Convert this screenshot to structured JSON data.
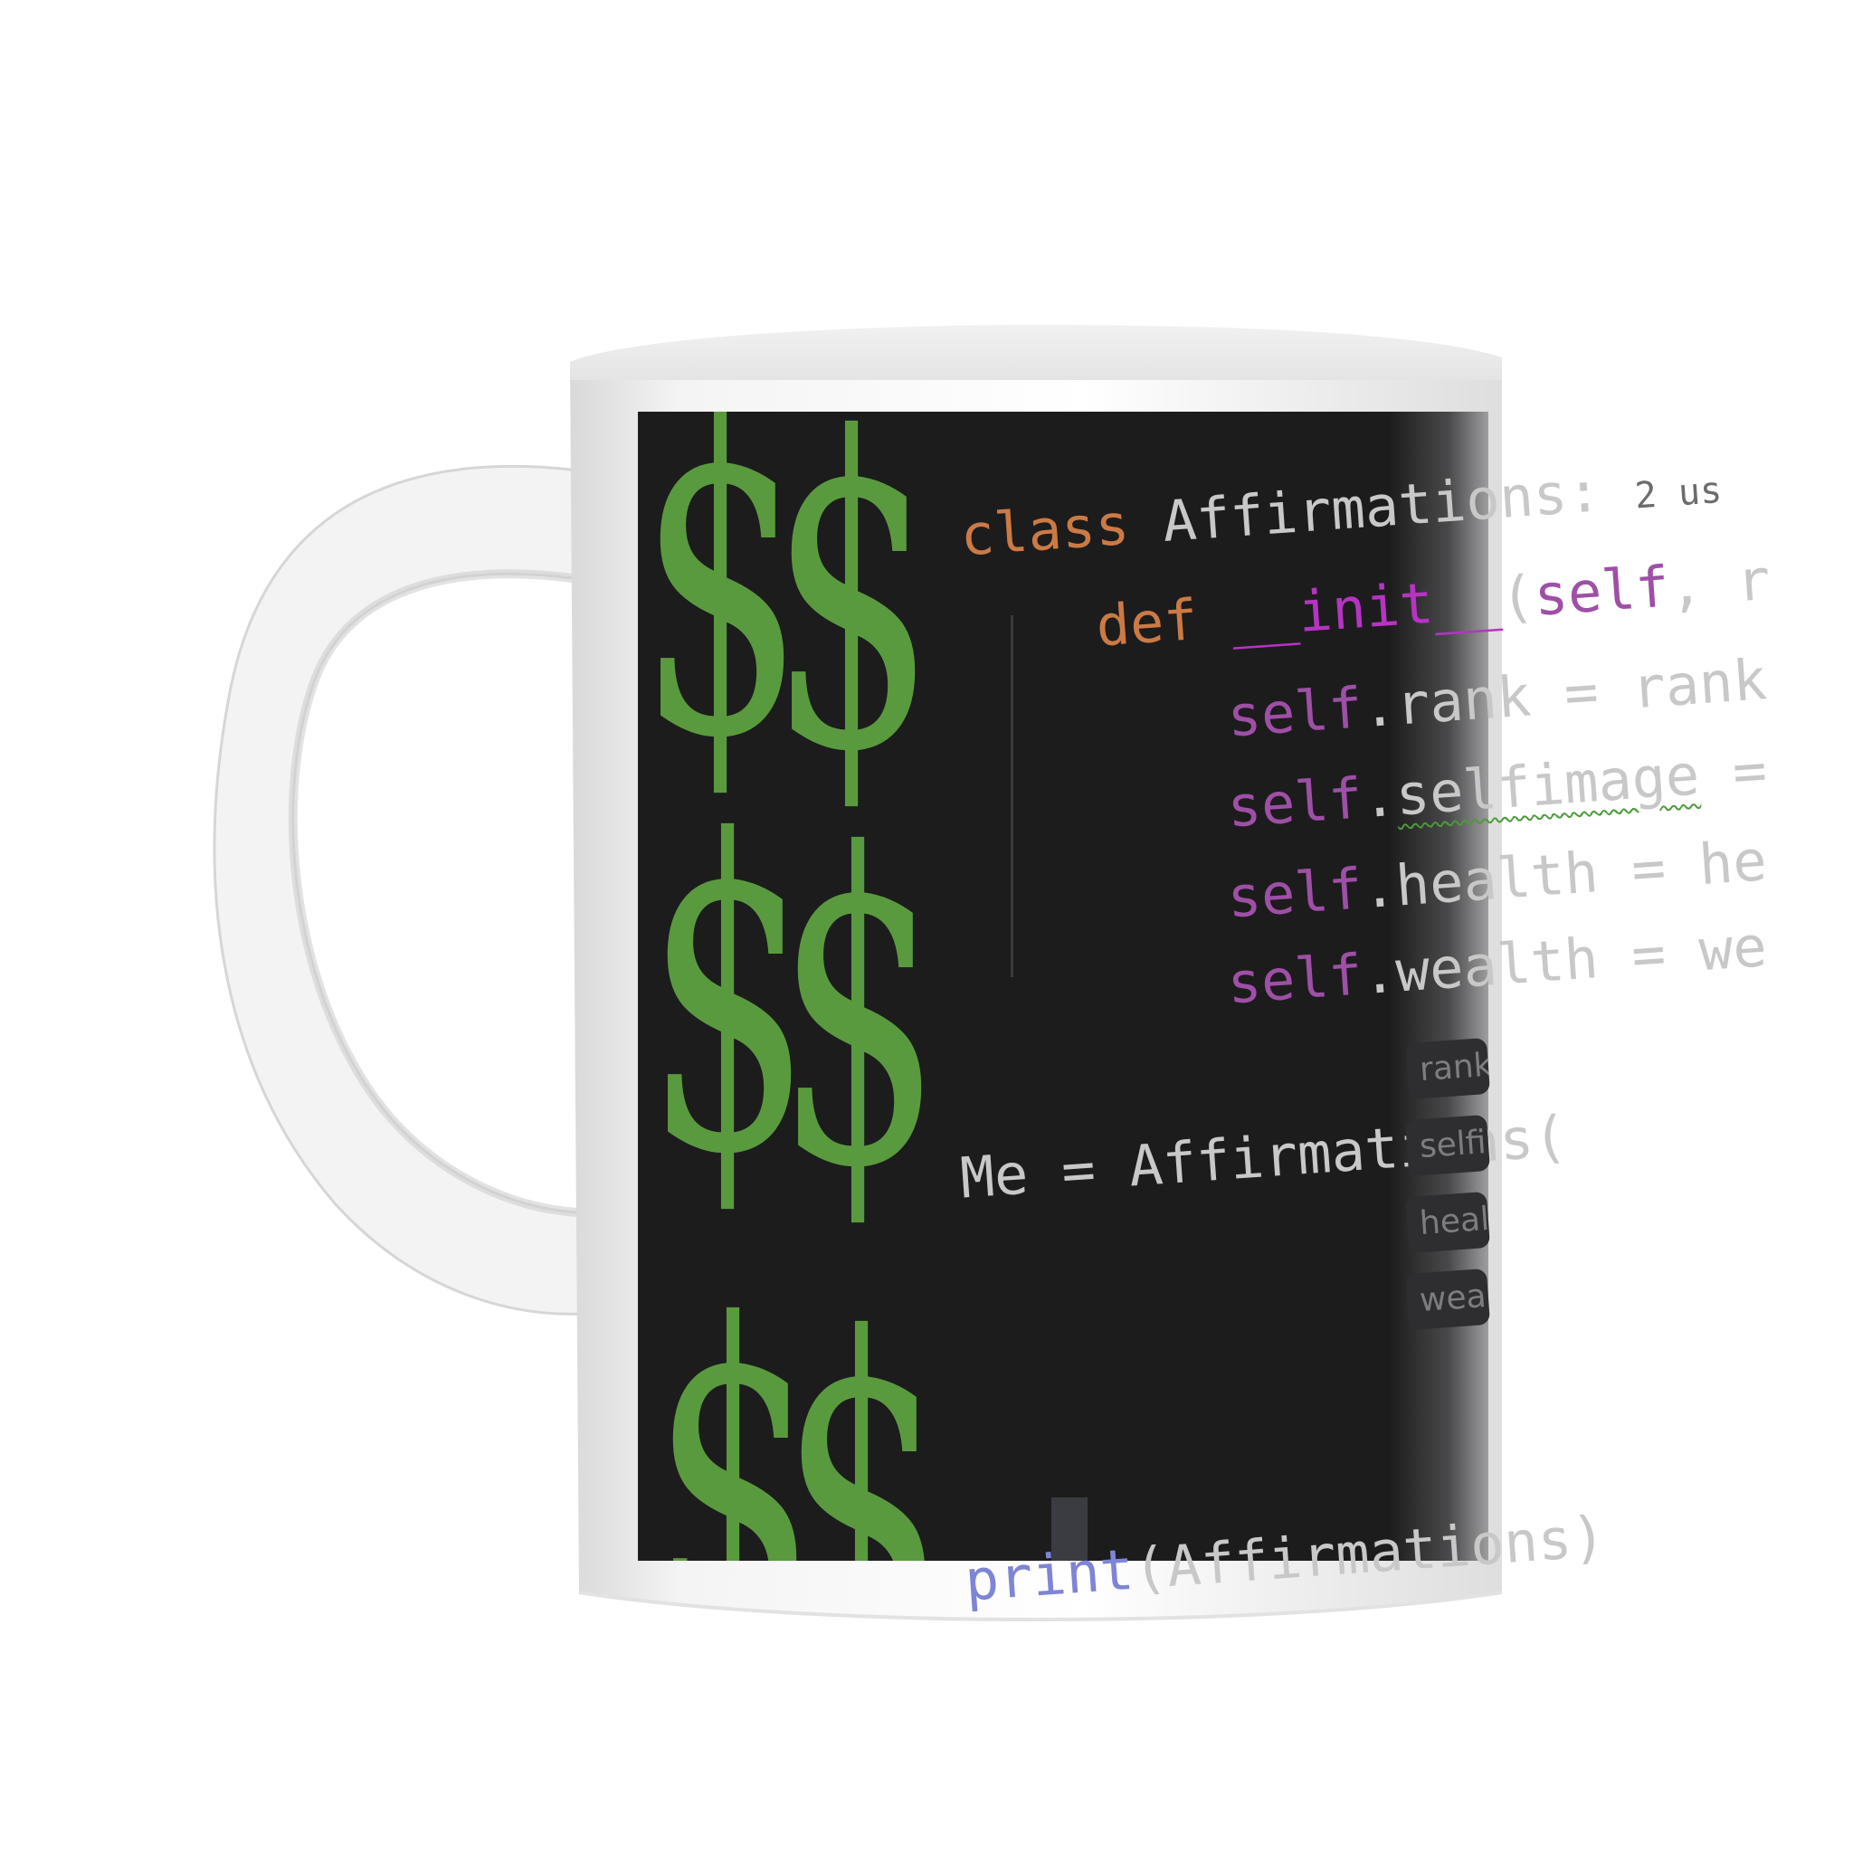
{
  "mug": {
    "body_color": "#ffffff",
    "print_background": "#1c1c1d",
    "dollar_color": "#5a9a3e",
    "dollar_glyph": "$"
  },
  "code": {
    "line1": {
      "keyword": "class",
      "name": "Affirmations:",
      "annotation": "2 us"
    },
    "line2": {
      "keyword": "def",
      "func": "__init__",
      "open": "(",
      "param": "self",
      "rest": ", r"
    },
    "line3": {
      "self": "self",
      "attr": ".rank",
      "assign": " = ",
      "value": "rank"
    },
    "line4": {
      "self": "self",
      "dot": ".",
      "attr": "selfimage",
      "assign": " ="
    },
    "line5": {
      "self": "self",
      "attr": ".health",
      "assign": " = ",
      "value": "he"
    },
    "line6": {
      "self": "self",
      "attr": ".wealth",
      "assign": " = ",
      "value": "we"
    },
    "line7": {
      "text": "Me = Affirmations("
    },
    "hints": [
      "rank:",
      "selfim",
      "health",
      "wealth"
    ],
    "line8": {
      "func": "print",
      "open": "(",
      "arg": "Affirmations)"
    }
  },
  "colors": {
    "keyword": "#cc7a45",
    "function": "#b634c2",
    "self": "#9e4fa6",
    "builtin": "#7e84d6",
    "text": "#c8c8c8"
  }
}
